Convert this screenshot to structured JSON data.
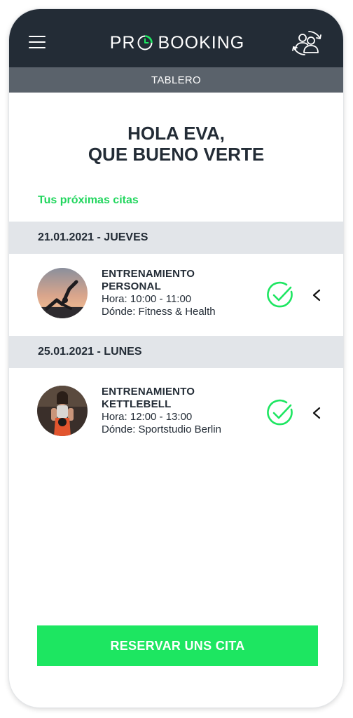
{
  "header": {
    "brand_pro": "PR",
    "brand_booking": "BOOKING",
    "menu_icon": "hamburger-menu-icon",
    "profile_icon": "users-switch-icon"
  },
  "subheader": {
    "title": "TABLERO"
  },
  "greeting": {
    "line1": "HOLA EVA,",
    "line2": "QUE BUENO VERTE"
  },
  "upcoming_label": "Tus próximas citas",
  "appointments": [
    {
      "date": "21.01.2021 - JUEVES",
      "title_line1": "ENTRENAMIENTO",
      "title_line2": "PERSONAL",
      "time": "Hora: 10:00 - 11:00",
      "place": "Dónde: Fitness & Health",
      "status_icon": "check-circle-icon",
      "action_icon": "chevron-left-icon"
    },
    {
      "date": "25.01.2021 - LUNES",
      "title_line1": "ENTRENAMIENTO",
      "title_line2": "KETTLEBELL",
      "time": "Hora: 12:00 - 13:00",
      "place": "Dónde: Sportstudio Berlin",
      "status_icon": "check-circle-icon",
      "action_icon": "chevron-left-icon"
    }
  ],
  "cta": {
    "label": "RESERVAR UNS CITA"
  },
  "colors": {
    "header_bg": "#232c36",
    "subheader_bg": "#5a626b",
    "accent_green": "#1de661",
    "date_bar_bg": "#e2e5e9",
    "text_dark": "#232c36"
  }
}
